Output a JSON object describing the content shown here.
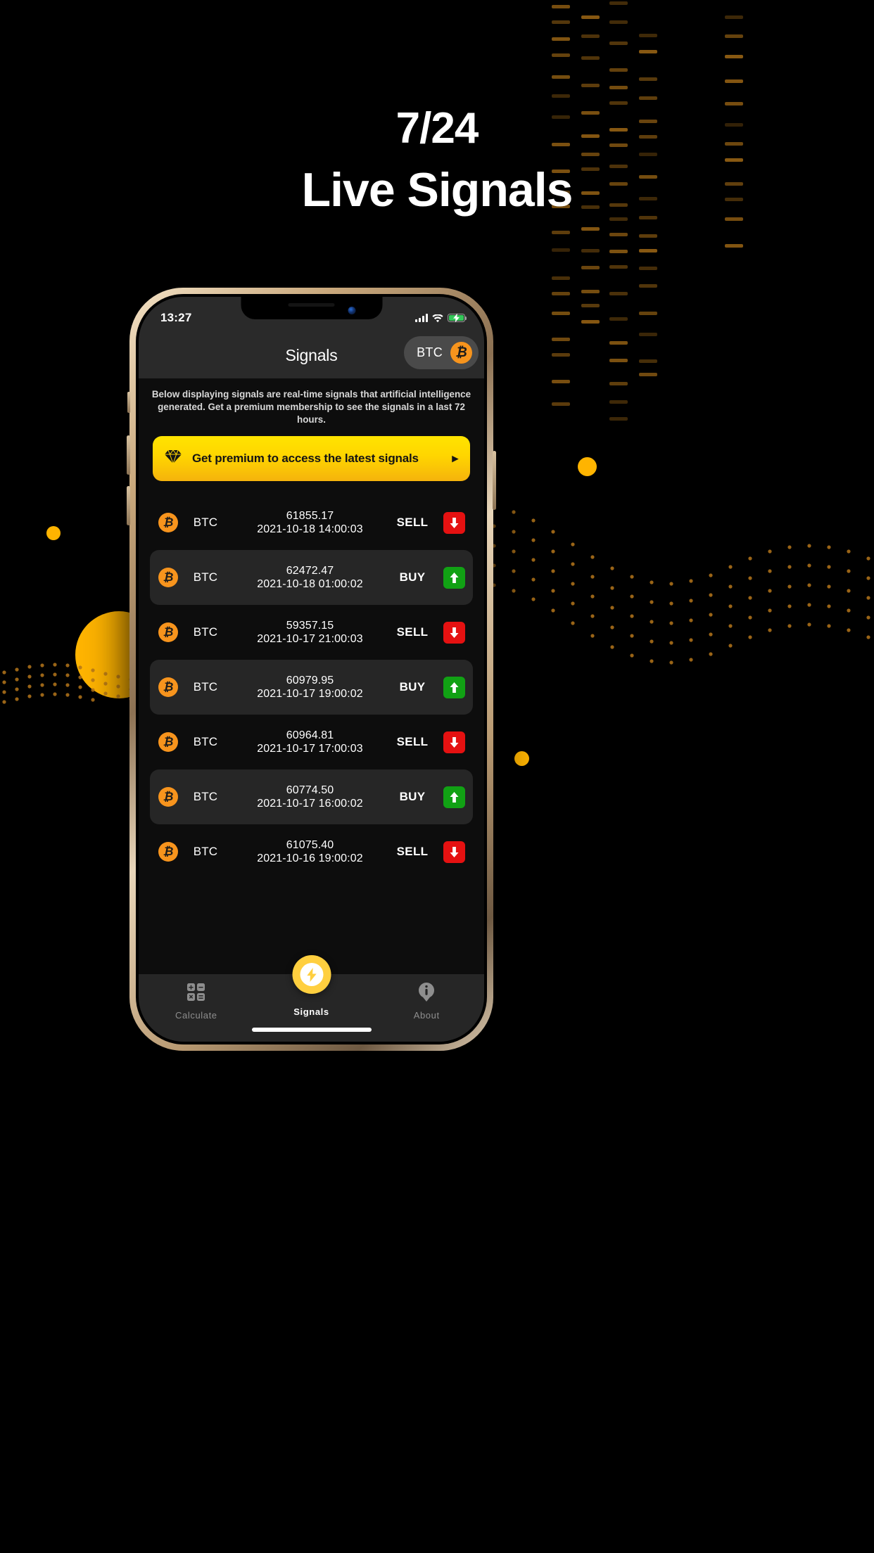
{
  "promo": {
    "line1": "7/24",
    "line2": "Live Signals"
  },
  "phone": {
    "status_bar": {
      "time": "13:27",
      "cellular_icon": "signal-bars-icon",
      "wifi_icon": "wifi-icon",
      "battery_icon": "battery-charging-icon",
      "battery_color": "#34c759"
    },
    "nav": {
      "title": "Signals",
      "coin_selector": {
        "label": "BTC",
        "icon": "bitcoin-icon",
        "icon_glyph": "Ƀ",
        "icon_color": "#f7941d"
      }
    },
    "description": "Below displaying signals are real-time signals that artificial intelligence generated. Get a premium membership to see the signals in a last 72 hours.",
    "premium_banner": {
      "icon": "diamond-icon",
      "label": "Get premium to access the latest signals",
      "chevron": "▸",
      "bg_start": "#ffe400",
      "bg_end": "#f5b30c",
      "text_color": "#141414"
    },
    "signals": [
      {
        "coin_icon": "bitcoin-icon",
        "symbol": "BTC",
        "price": "61855.17",
        "time": "2021-10-18 14:00:03",
        "action": "SELL",
        "direction": "down",
        "color": "#e51111"
      },
      {
        "coin_icon": "bitcoin-icon",
        "symbol": "BTC",
        "price": "62472.47",
        "time": "2021-10-18 01:00:02",
        "action": "BUY",
        "direction": "up",
        "color": "#11a114"
      },
      {
        "coin_icon": "bitcoin-icon",
        "symbol": "BTC",
        "price": "59357.15",
        "time": "2021-10-17 21:00:03",
        "action": "SELL",
        "direction": "down",
        "color": "#e51111"
      },
      {
        "coin_icon": "bitcoin-icon",
        "symbol": "BTC",
        "price": "60979.95",
        "time": "2021-10-17 19:00:02",
        "action": "BUY",
        "direction": "up",
        "color": "#11a114"
      },
      {
        "coin_icon": "bitcoin-icon",
        "symbol": "BTC",
        "price": "60964.81",
        "time": "2021-10-17 17:00:03",
        "action": "SELL",
        "direction": "down",
        "color": "#e51111"
      },
      {
        "coin_icon": "bitcoin-icon",
        "symbol": "BTC",
        "price": "60774.50",
        "time": "2021-10-17 16:00:02",
        "action": "BUY",
        "direction": "up",
        "color": "#11a114"
      },
      {
        "coin_icon": "bitcoin-icon",
        "symbol": "BTC",
        "price": "61075.40",
        "time": "2021-10-16 19:00:02",
        "action": "SELL",
        "direction": "down",
        "color": "#e51111"
      }
    ],
    "tabs": [
      {
        "label": "Calculate",
        "icon": "calculator-icon",
        "active": false
      },
      {
        "label": "Signals",
        "icon": "lightning-bolt-icon",
        "active": true
      },
      {
        "label": "About",
        "icon": "info-icon",
        "active": false
      }
    ]
  }
}
